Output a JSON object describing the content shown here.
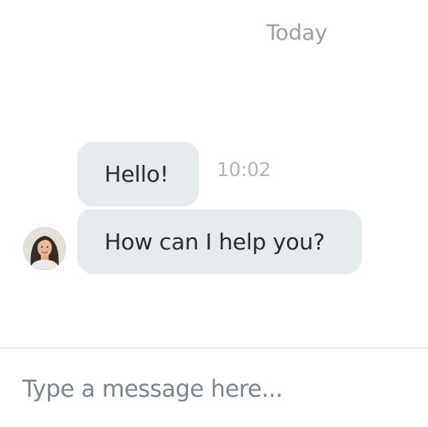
{
  "chat": {
    "date_label": "Today",
    "messages": [
      {
        "text": "Hello!",
        "time": "10:02"
      },
      {
        "text": "How can I help you?"
      }
    ]
  },
  "composer": {
    "placeholder": "Type a message here..."
  },
  "colors": {
    "bubble_background": "#e6ecee",
    "muted_text": "#9aa1a6",
    "divider": "#e9ecee"
  },
  "icons": {
    "avatar": "agent-avatar-photo"
  }
}
